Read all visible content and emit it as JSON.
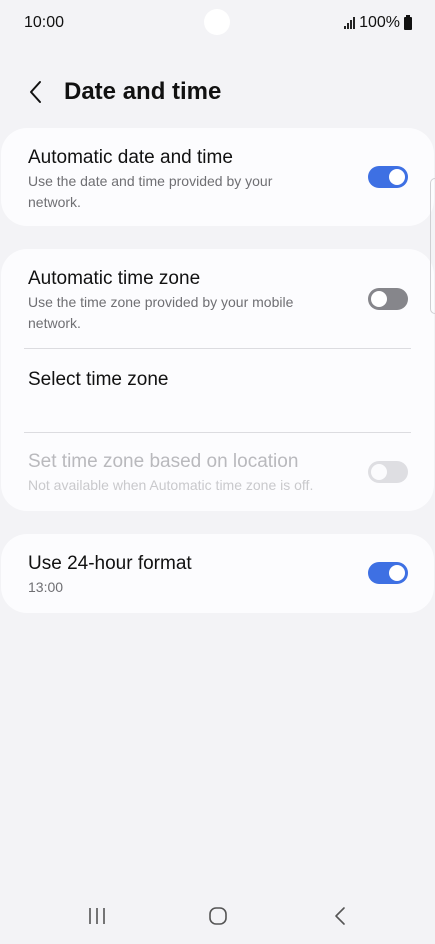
{
  "status_bar": {
    "time": "10:00",
    "battery": "100%"
  },
  "header": {
    "title": "Date and time"
  },
  "settings": {
    "auto_date_time": {
      "title": "Automatic date and time",
      "subtitle": "Use the date and time provided by your network.",
      "enabled": true
    },
    "auto_time_zone": {
      "title": "Automatic time zone",
      "subtitle": "Use the time zone provided by your mobile network.",
      "enabled": false
    },
    "select_time_zone": {
      "title": "Select time zone"
    },
    "location_time_zone": {
      "title": "Set time zone based on location",
      "subtitle": "Not available when Automatic time zone is off.",
      "enabled": false,
      "disabled": true
    },
    "format_24h": {
      "title": "Use 24-hour format",
      "subtitle": "13:00",
      "enabled": true
    }
  },
  "colors": {
    "accent": "#3e70e3",
    "background": "#f3f3f6",
    "card": "#fcfcfe"
  },
  "icons": {
    "back": "chevron-left-icon",
    "nav_recents": "recents-icon",
    "nav_home": "home-icon",
    "nav_back": "back-icon"
  }
}
